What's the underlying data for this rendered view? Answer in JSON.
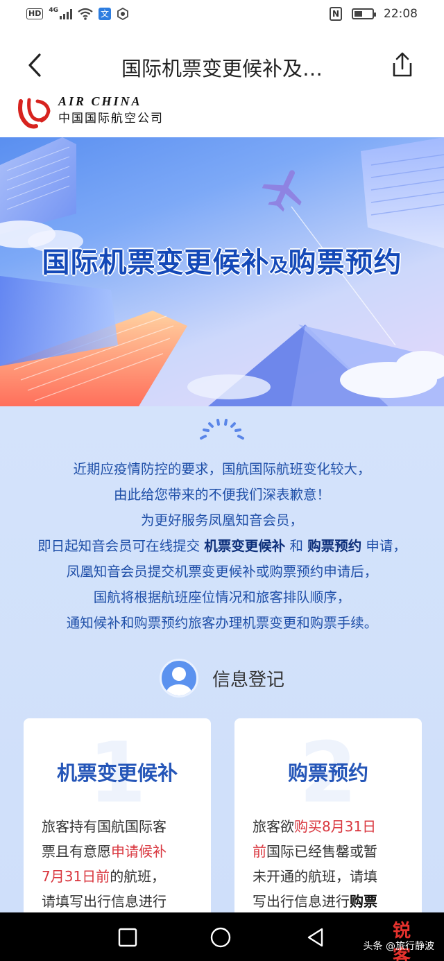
{
  "status_bar": {
    "left_badge": "HD",
    "network": "4G",
    "nfc_label": "N",
    "time": "22:08"
  },
  "header": {
    "title": "国际机票变更候补及…"
  },
  "logo": {
    "english": "AIR CHINA",
    "chinese": "中国国际航空公司"
  },
  "banner": {
    "title_part1": "国际机票变更候补",
    "title_part2": "及",
    "title_part3": "购票预约"
  },
  "notice": {
    "line1": "近期应疫情防控的要求，国航国际航班变化较大，",
    "line2": "由此给您带来的不便我们深表歉意！",
    "line3": "为更好服务凤凰知音会员，",
    "line4_pre": "即日起知音会员可在线提交 ",
    "line4_b1": "机票变更候补",
    "line4_mid": " 和 ",
    "line4_b2": "购票预约",
    "line4_post": " 申请，",
    "line5": "凤凰知音会员提交机票变更候补或购票预约申请后，",
    "line6": "国航将根据航班座位情况和旅客排队顺序，",
    "line7": "通知候补和购票预约旅客办理机票变更和购票手续。"
  },
  "registration": {
    "label": "信息登记"
  },
  "cards": [
    {
      "number": "1",
      "title": "机票变更候补",
      "line1": "旅客持有国航国际客",
      "line2_pre": "票且有意愿",
      "line2_red": "申请候补",
      "line3_red": "7月31日前",
      "line3_post": "的航班，",
      "line4": "请填写出行信息进行"
    },
    {
      "number": "2",
      "title": "购票预约",
      "line1_pre": "旅客欲",
      "line1_red": "购买8月31日",
      "line2_red": "前",
      "line2_post": "国际已经售罄或暂",
      "line3": "未开通的航班，请填",
      "line4_pre": "写出行信息进行",
      "line4_b": "购票"
    }
  ],
  "watermark": {
    "site": "锐客网",
    "text": "头条 @旅行静波"
  },
  "colors": {
    "accent": "#2556b8",
    "highlight_red": "#d9363e",
    "notice_text": "#1f4fa8"
  }
}
